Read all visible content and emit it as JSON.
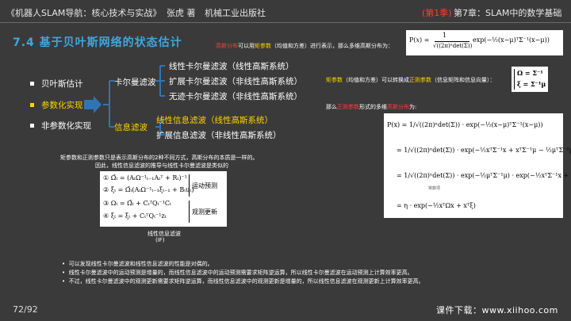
{
  "header": {
    "book_title": "《机器人SLAM导航：核心技术与实战》",
    "author": "张虎 著",
    "publisher": "机械工业出版社",
    "volume": "(第1季)",
    "chapter": "第7章：SLAM中的数学基础"
  },
  "slide": {
    "title": "7.4  基于贝叶斯网络的状态估计",
    "page_number": "72/92",
    "footer_download": "课件下载：www.xiihoo.com"
  },
  "tree": {
    "root_items": [
      "贝叶斯估计",
      "参数化实现",
      "非参数化实现"
    ],
    "branch_kalman": "卡尔曼滤波",
    "branch_info": "信息滤波",
    "kalman_items": [
      "线性卡尔曼滤波（线性高斯系统）",
      "扩展卡尔曼滤波（非线性高斯系统）",
      "无迹卡尔曼滤波（非线性高斯系统）"
    ],
    "info_items": [
      "线性信息滤波（线性高斯系统）",
      "扩展信息滤波（非线性高斯系统）"
    ]
  },
  "notes": {
    "top_a": "高斯分布",
    "top_b": "可以用",
    "top_c": "矩参数",
    "top_d": "（均值和方差）进行表示，那么多维高斯分布为：",
    "mid_a": "矩参数",
    "mid_b": "（均值和方差）可以转换成",
    "mid_c": "正则参数",
    "mid_d": "（信息矩阵和信息向量）：",
    "canon_a": "那么",
    "canon_b": "正则参数",
    "canon_c": "形式的多维",
    "canon_d": "高斯分布",
    "canon_e": "为:",
    "compare_line1": "矩参数和正则参数只是表示高斯分布的2种不同方式，高斯分布的本质是一样的。",
    "compare_line2": "因此，线性信息滤波的推导与线性卡尔曼滤波是类似的",
    "const_label": "常数项",
    "filter_caption_1": "线性信息滤波",
    "filter_caption_2": "(IF)",
    "motion_label": "运动预测",
    "observe_label": "观测更新"
  },
  "bottom_bullets": [
    "可以发现线性卡尔曼滤波和线性信息滤波的性能是对偶的。",
    "线性卡尔曼滤波中的运动预测是增量的，而线性信息滤波中的运动预测需要求矩阵逆运算，所以线性卡尔曼滤波在运动预测上计算效率更高。",
    "不过，线性卡尔曼滤波中的观测更新需要求矩阵逆运算，而线性信息滤波中的观测更新是增量的，所以线性信息滤波在观测更新上计算效率更高。"
  ],
  "formulas": {
    "gauss_moment": "P(x) = exp(−½(x−μ)ᵀΣ⁻¹(x−μ)) / √((2π)ⁿ det(Σ))",
    "omega": "Ω = Σ⁻¹",
    "xi": "ξ = Σ⁻¹μ",
    "canon_1": "P(x) = 1/√((2π)ⁿdet(Σ)) · exp(−½(x−μ)ᵀΣ⁻¹(x−μ))",
    "canon_2": "= 1/√((2π)ⁿdet(Σ)) · exp(−½xᵀΣ⁻¹x + xᵀΣ⁻¹μ − ½μᵀΣ⁻¹μ)",
    "canon_3": "= 1/√((2π)ⁿdet(Σ)) · exp(−½μᵀΣ⁻¹μ) · exp(−½xᵀΣ⁻¹x + xᵀΣ⁻¹μ)",
    "canon_4": "= η · exp(−½xᵀΩx + xᵀξ)",
    "if_1": "①  Ω̄ₜ = (AₜΩ⁻¹ₜ₋₁Aₜᵀ + Rₜ)⁻¹",
    "if_2": "②  ξ̄ₜ = Ω̄ₜ(AₜΩ⁻¹ₜ₋₁ξₜ₋₁ + Bₜuₜ)",
    "if_3": "③  Ωₜ = Ω̄ₜ + CₜᵀQₜ⁻¹Cₜ",
    "if_4": "④  ξₜ = ξ̄ₜ + CₜᵀQₜ⁻¹zₜ"
  },
  "colors": {
    "background": "#3a3a3a",
    "title_blue": "#3fa7e0",
    "highlight_red": "#ff3b3b",
    "highlight_yellow": "#ffd400",
    "arrow_blue": "#2e75b6"
  }
}
